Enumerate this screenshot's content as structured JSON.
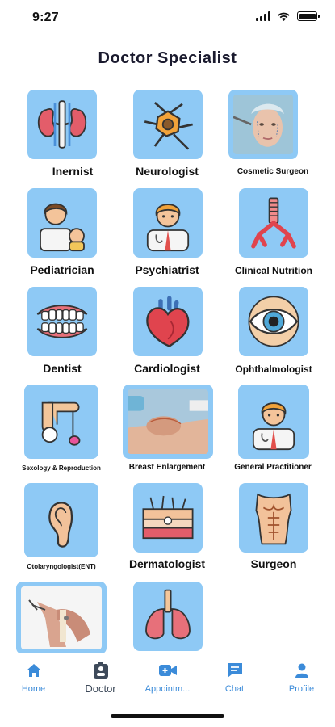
{
  "status": {
    "time": "9:27"
  },
  "page": {
    "title": "Doctor Specialist"
  },
  "specialists": [
    {
      "label": "Inernist",
      "icon": "kidneys-icon"
    },
    {
      "label": "Neurologist",
      "icon": "neuron-icon"
    },
    {
      "label": "Cosmetic Surgeon",
      "icon": "cosmetic-face-photo"
    },
    {
      "label": "Pediatrician",
      "icon": "pediatrician-icon"
    },
    {
      "label": "Psychiatrist",
      "icon": "doctor-icon"
    },
    {
      "label": "Clinical Nutrition",
      "icon": "trachea-icon"
    },
    {
      "label": "Dentist",
      "icon": "teeth-icon"
    },
    {
      "label": "Cardiologist",
      "icon": "heart-icon"
    },
    {
      "label": "Ophthalmologist",
      "icon": "eye-icon"
    },
    {
      "label": "Sexology & Reproduction",
      "icon": "reproduction-icon"
    },
    {
      "label": "Breast Enlargement",
      "icon": "breast-surgery-photo"
    },
    {
      "label": "General Practitioner",
      "icon": "doctor-icon"
    },
    {
      "label": "Otolaryngologist(ENT)",
      "icon": "ear-icon"
    },
    {
      "label": "Dermatologist",
      "icon": "skin-icon"
    },
    {
      "label": "Surgeon",
      "icon": "torso-icon"
    },
    {
      "label": "",
      "icon": "orthopedic-photo"
    },
    {
      "label": "",
      "icon": "lungs-icon"
    }
  ],
  "tabs": [
    {
      "label": "Home",
      "icon": "home-icon",
      "active": false
    },
    {
      "label": "Doctor",
      "icon": "doctor-badge-icon",
      "active": true
    },
    {
      "label": "Appointm...",
      "icon": "video-camera-icon",
      "active": false
    },
    {
      "label": "Chat",
      "icon": "chat-icon",
      "active": false
    },
    {
      "label": "Profile",
      "icon": "person-icon",
      "active": false
    }
  ],
  "colors": {
    "tile_bg": "#8ec9f5",
    "tab_active": "#3e4a5a",
    "tab_inactive": "#3b8bd9"
  }
}
